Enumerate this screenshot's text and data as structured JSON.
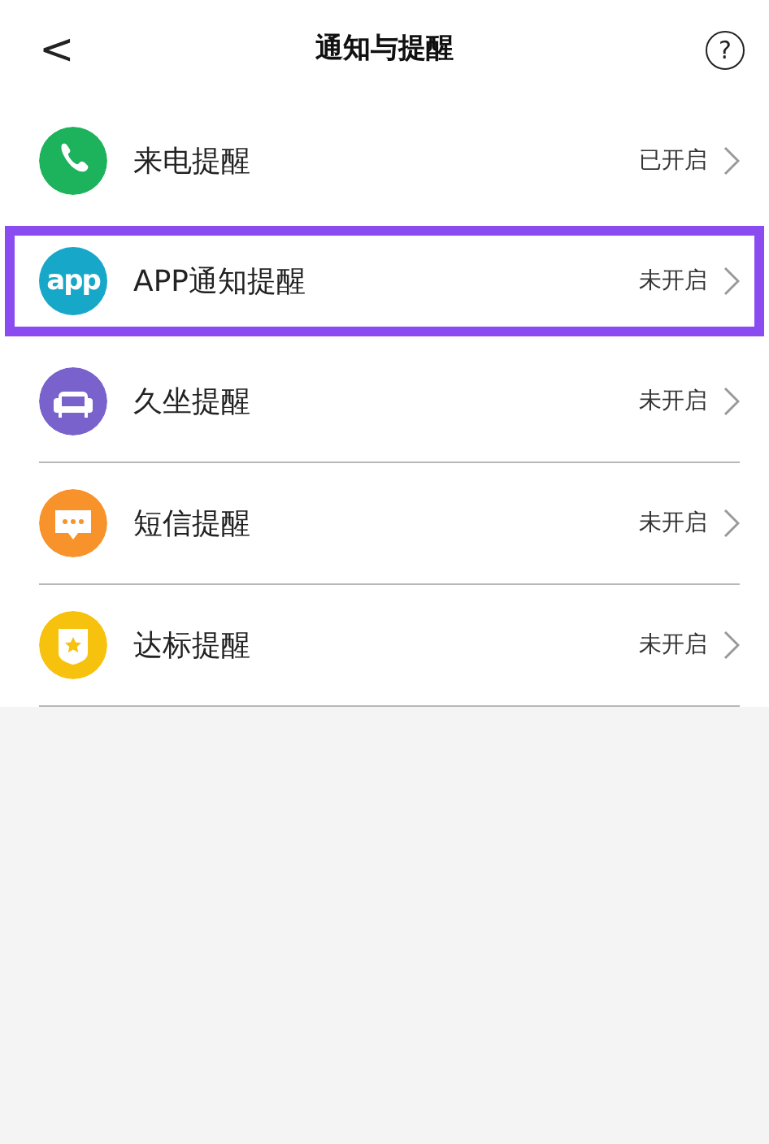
{
  "header": {
    "back": "<",
    "title": "通知与提醒",
    "help": "?"
  },
  "items": [
    {
      "kind": "phone",
      "color": "#1db35c",
      "label": "来电提醒",
      "status": "已开启",
      "highlighted": false
    },
    {
      "kind": "app",
      "color": "#17a8c9",
      "icon_text": "app",
      "label": "APP通知提醒",
      "status": "未开启",
      "highlighted": true
    },
    {
      "kind": "sofa",
      "color": "#7a62cc",
      "label": "久坐提醒",
      "status": "未开启",
      "highlighted": false
    },
    {
      "kind": "message",
      "color": "#f7932a",
      "label": "短信提醒",
      "status": "未开启",
      "highlighted": false
    },
    {
      "kind": "badge",
      "color": "#f6c20e",
      "label": "达标提醒",
      "status": "未开启",
      "highlighted": false
    }
  ]
}
